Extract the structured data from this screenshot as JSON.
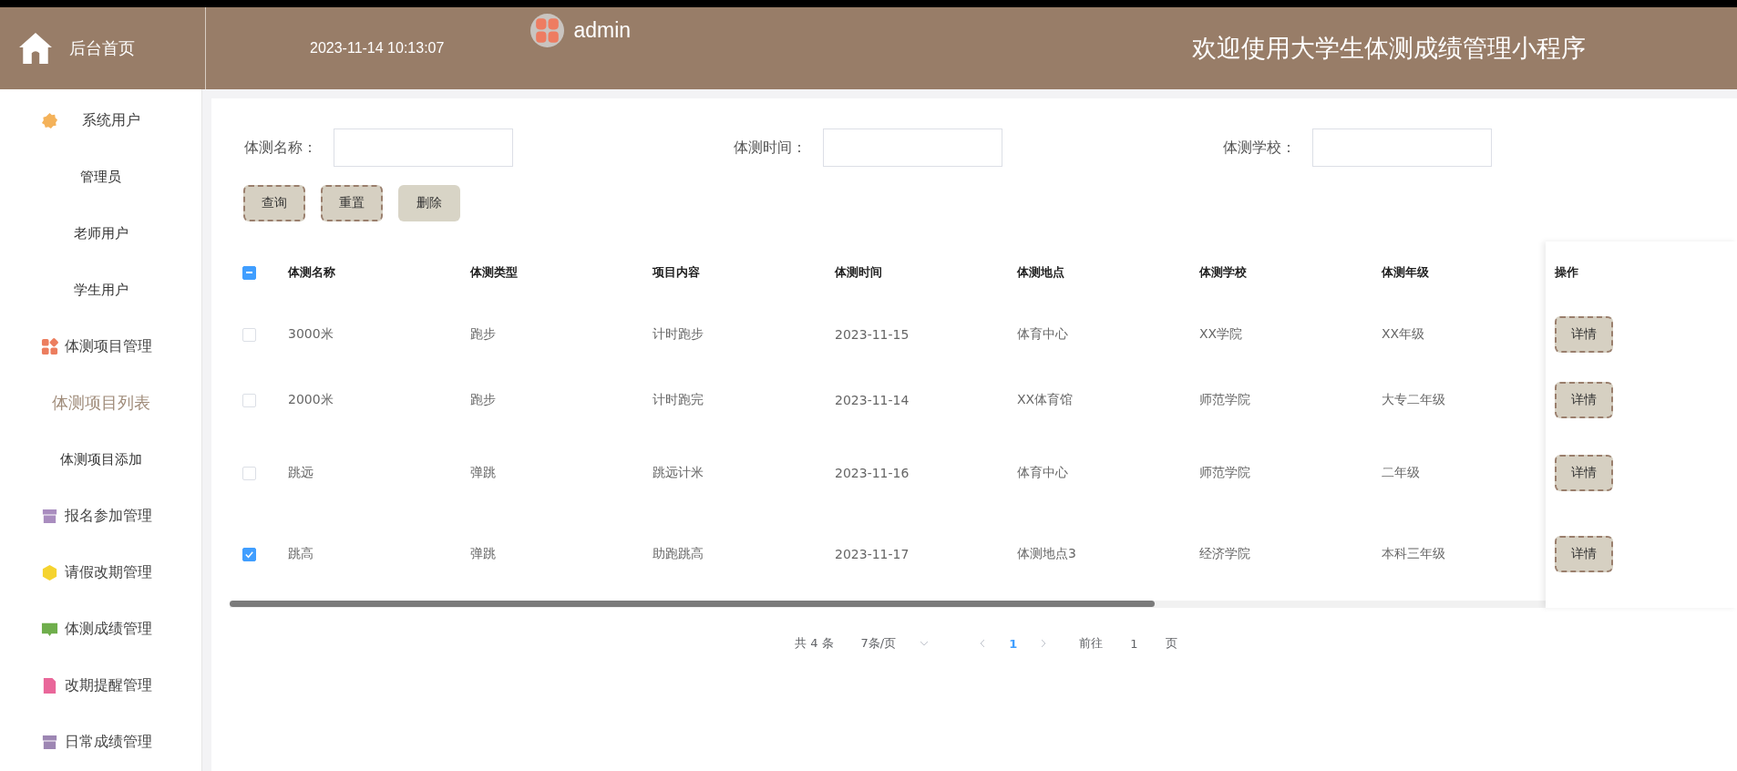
{
  "header": {
    "home_label": "后台首页",
    "datetime": "2023-11-14 10:13:07",
    "user": "admin",
    "title": "欢迎使用大学生体测成绩管理小程序"
  },
  "sidebar": {
    "items": [
      {
        "label": "系统用户",
        "kind": "group",
        "selected": false,
        "color": "#f4b25a"
      },
      {
        "label": "管理员",
        "kind": "child",
        "selected": false
      },
      {
        "label": "老师用户",
        "kind": "child",
        "selected": false
      },
      {
        "label": "学生用户",
        "kind": "child",
        "selected": false
      },
      {
        "label": "体测项目管理",
        "kind": "group",
        "selected": false,
        "color": "#ec7d5e"
      },
      {
        "label": "体测项目列表",
        "kind": "child",
        "selected": true
      },
      {
        "label": "体测项目添加",
        "kind": "child",
        "selected": false
      },
      {
        "label": "报名参加管理",
        "kind": "group",
        "selected": false,
        "color": "#a98dbf"
      },
      {
        "label": "请假改期管理",
        "kind": "group",
        "selected": false,
        "color": "#f5d330"
      },
      {
        "label": "体测成绩管理",
        "kind": "group",
        "selected": false,
        "color": "#6fae4c"
      },
      {
        "label": "改期提醒管理",
        "kind": "group",
        "selected": false,
        "color": "#e9679a"
      },
      {
        "label": "日常成绩管理",
        "kind": "group",
        "selected": false,
        "color": "#9d86b3"
      }
    ]
  },
  "search": {
    "fields": [
      {
        "label": "体测名称："
      },
      {
        "label": "体测时间："
      },
      {
        "label": "体测学校："
      }
    ],
    "buttons": [
      {
        "label": "查询",
        "hovered": false
      },
      {
        "label": "重置",
        "hovered": false
      },
      {
        "label": "删除",
        "hovered": true
      }
    ]
  },
  "table": {
    "select_all": {
      "indeterminate": true
    },
    "columns": [
      "体测名称",
      "体测类型",
      "项目内容",
      "体测时间",
      "体测地点",
      "体测学校",
      "体测年级",
      "操作"
    ],
    "rows": [
      {
        "checked": false,
        "cells": [
          "3000米",
          "跑步",
          "计时跑步",
          "2023-11-15",
          "体育中心",
          "XX学院",
          "XX年级"
        ],
        "action": "详情"
      },
      {
        "checked": false,
        "cells": [
          "2000米",
          "跑步",
          "计时跑完",
          "2023-11-14",
          "XX体育馆",
          "师范学院",
          "大专二年级"
        ],
        "action": "详情"
      },
      {
        "checked": false,
        "cells": [
          "跳远",
          "弹跳",
          "跳远计米",
          "2023-11-16",
          "体育中心",
          "师范学院",
          "二年级"
        ],
        "action": "详情"
      },
      {
        "checked": true,
        "cells": [
          "跳高",
          "弹跳",
          "助跑跳高",
          "2023-11-17",
          "体测地点3",
          "经济学院",
          "本科三年级"
        ],
        "action": "详情"
      }
    ]
  },
  "pagination": {
    "total": "共 4 条",
    "page_size": "7条/页",
    "current_page": "1",
    "goto_label": "前往",
    "goto_value": "1",
    "page_suffix": "页"
  }
}
